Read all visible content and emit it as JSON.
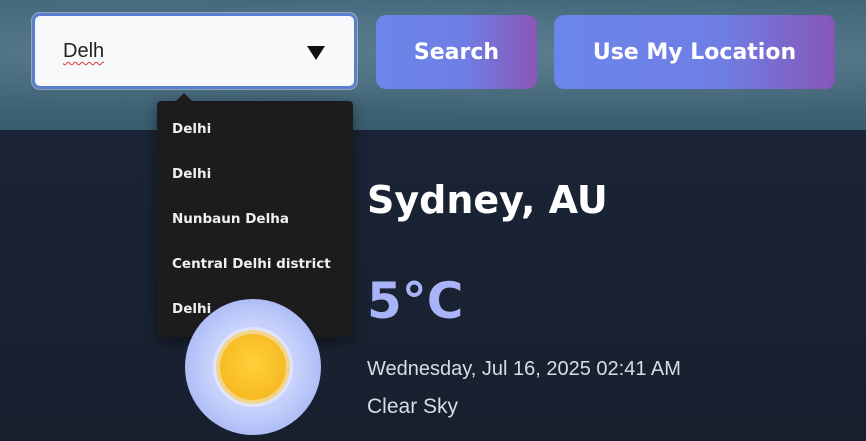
{
  "search": {
    "value": "Delh",
    "search_label": "Search",
    "location_label": "Use My Location"
  },
  "suggestions": [
    "Delhi",
    "Delhi",
    "Nunbaun Delha",
    "Central Delhi district",
    "Delhi"
  ],
  "weather": {
    "city": "Sydney, AU",
    "temperature": "5°C",
    "datetime": "Wednesday, Jul 16, 2025 02:41 AM",
    "condition": "Clear Sky",
    "icon": "sun-icon"
  },
  "colors": {
    "accent_start": "#6b86ea",
    "accent_end": "#8a56b7",
    "temperature": "#a9b4f8",
    "background": "#19212f",
    "sun": "#fec52e"
  }
}
